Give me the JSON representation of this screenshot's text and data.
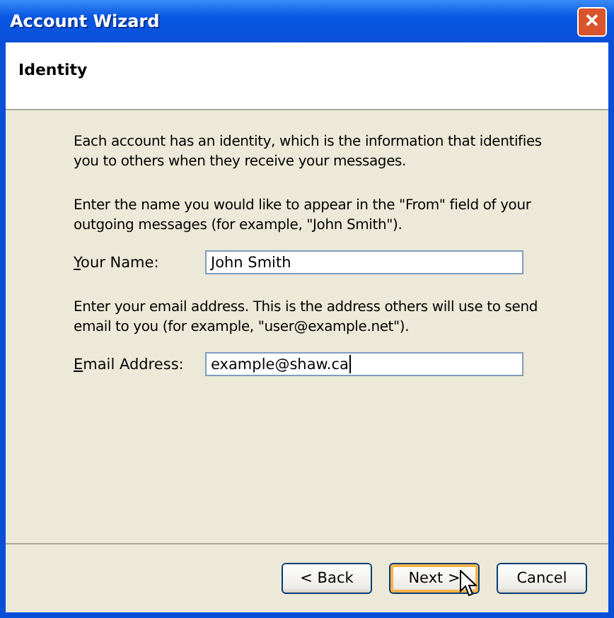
{
  "window": {
    "title": "Account Wizard",
    "close": "✕"
  },
  "header": {
    "title": "Identity"
  },
  "intro": "Each account has an identity, which is the information that identifies you to others when they receive your messages.",
  "sections": [
    {
      "text": "Enter the name you would like to appear in the \"From\" field of your outgoing messages (for example, \"John Smith\").",
      "label": "Your Name:",
      "value": "John Smith",
      "focused": false
    },
    {
      "text": "Enter your email address. This is the address others will use to send email to you (for example, \"user@example.net\").",
      "label": "Email Address:",
      "value": "example@shaw.ca",
      "focused": true
    }
  ],
  "buttons": [
    {
      "label": "< Back",
      "default": false
    },
    {
      "label": "Next >",
      "default": true
    },
    {
      "label": "Cancel",
      "default": false
    }
  ]
}
